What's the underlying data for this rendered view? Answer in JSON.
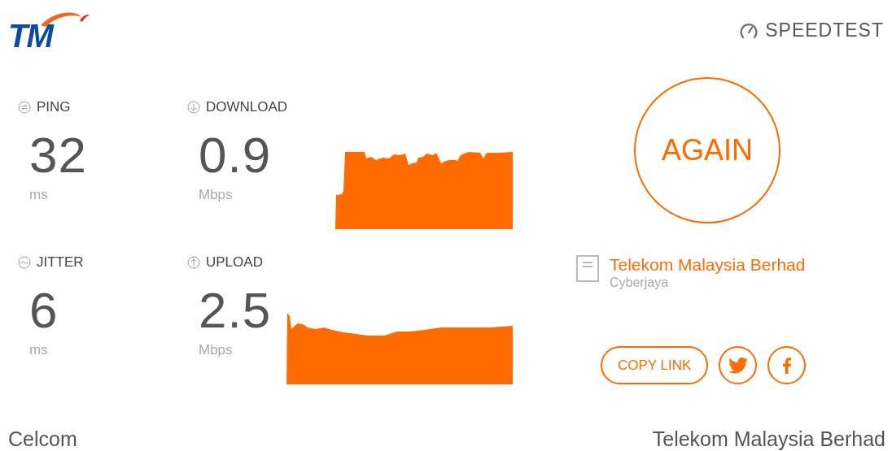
{
  "logo": {
    "text": "TM"
  },
  "brand": {
    "text": "SPEEDTEST"
  },
  "metrics": [
    {
      "kind": "ping",
      "label": "PING",
      "value": "32",
      "unit": "ms"
    },
    {
      "kind": "download",
      "label": "DOWNLOAD",
      "value": "0.9",
      "unit": "Mbps"
    },
    {
      "kind": "jitter",
      "label": "JITTER",
      "value": "6",
      "unit": "ms"
    },
    {
      "kind": "upload",
      "label": "UPLOAD",
      "value": "2.5",
      "unit": "Mbps"
    }
  ],
  "again_button": {
    "label": "AGAIN"
  },
  "server": {
    "name": "Telekom Malaysia Berhad",
    "location": "Cyberjaya"
  },
  "share": {
    "copy_link": "COPY LINK"
  },
  "footer": {
    "isp": "Celcom",
    "server": "Telekom Malaysia Berhad"
  }
}
